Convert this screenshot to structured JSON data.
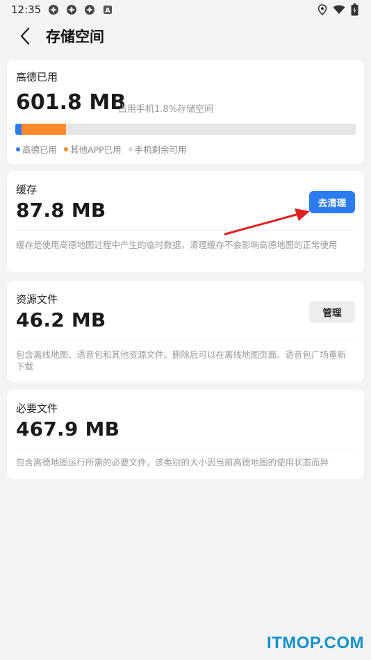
{
  "status_bar": {
    "time": "12:35",
    "icons_left": [
      "app-icon",
      "app-icon",
      "app-icon",
      "a-badge-icon"
    ],
    "icons_right": [
      "location-icon",
      "wifi-icon",
      "battery-icon"
    ],
    "badge_letter": "A"
  },
  "header": {
    "title": "存储空间"
  },
  "usage": {
    "label": "高德已用",
    "total": "601.8 MB",
    "note": "占用手机1.8%存储空间",
    "segments": [
      {
        "name": "高德已用",
        "fraction": 0.018,
        "color": "#2b7bf3"
      },
      {
        "name": "其他APP已用",
        "fraction": 0.13,
        "color": "#ff8a2b"
      },
      {
        "name": "手机剩余可用",
        "fraction": 0.852,
        "color": "#e5e5e5"
      }
    ]
  },
  "cache": {
    "label": "缓存",
    "size": "87.8 MB",
    "button": "去清理",
    "desc": "缓存是使用高德地图过程中产生的临时数据，清理缓存不会影响高德地图的正常使用"
  },
  "resources": {
    "label": "资源文件",
    "size": "46.2 MB",
    "button": "管理",
    "desc": "包含离线地图、语音包和其他资源文件。删除后可以在离线地图页面、语音包广场重新下载"
  },
  "required": {
    "label": "必要文件",
    "size": "467.9 MB",
    "desc": "包含高德地图运行所需的必要文件，该类别的大小因当前高德地图的使用状态而异"
  },
  "colors": {
    "accent": "#2b7bf3",
    "other_apps": "#ff8a2b",
    "remaining": "#e5e5e5",
    "annotation_arrow": "#e02020",
    "watermark": "#1590c8"
  },
  "watermark": "ITMOP.COM"
}
